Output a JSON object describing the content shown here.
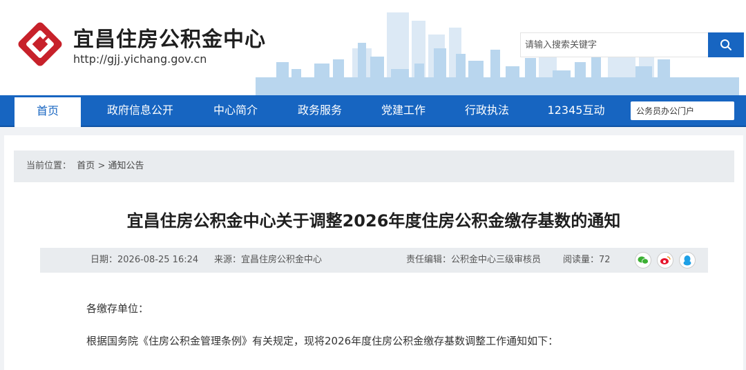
{
  "header": {
    "site_name": "宜昌住房公积金中心",
    "site_url": "http://gjj.yichang.gov.cn",
    "search_placeholder": "请输入搜索关键字",
    "logo_icon": "yichang-hpf-logo-icon",
    "search_icon": "search-icon",
    "brand_color": "#1765c1",
    "logo_color": "#c7212a"
  },
  "nav": {
    "items": [
      {
        "label": "首页",
        "active": true
      },
      {
        "label": "政府信息公开",
        "active": false
      },
      {
        "label": "中心简介",
        "active": false
      },
      {
        "label": "政务服务",
        "active": false
      },
      {
        "label": "党建工作",
        "active": false
      },
      {
        "label": "行政执法",
        "active": false
      },
      {
        "label": "12345互动",
        "active": false
      }
    ],
    "portal_placeholder": "公务员办公门户"
  },
  "breadcrumb": {
    "prefix": "当前位置：",
    "home": "首页",
    "separator": ">",
    "current": "通知公告"
  },
  "article": {
    "title": "宜昌住房公积金中心关于调整2026年度住房公积金缴存基数的通知",
    "meta": {
      "date": "日期：2026-08-25 16:24",
      "source": "来源：宜昌住房公积金中心",
      "editor": "责任编辑：公积金中心三级审核员",
      "reads": "阅读量：72"
    },
    "share": [
      {
        "name": "wechat-share-icon",
        "color": "#3cb034"
      },
      {
        "name": "weibo-share-icon",
        "color": "#e6162d"
      },
      {
        "name": "qq-share-icon",
        "color": "#1ea0e6"
      }
    ],
    "paragraphs": [
      "各缴存单位：",
      "根据国务院《住房公积金管理条例》有关规定，现将2026年度住房公积金缴存基数调整工作通知如下："
    ]
  }
}
